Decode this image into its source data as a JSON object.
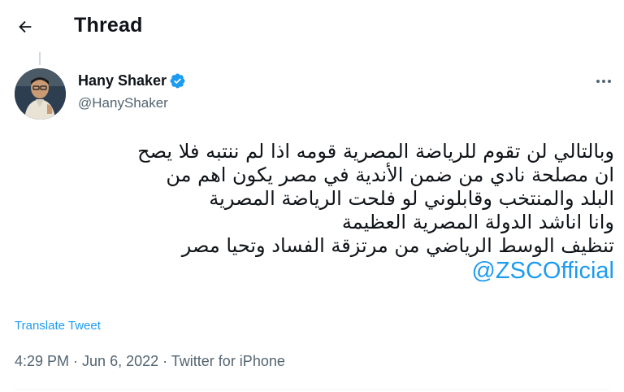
{
  "header": {
    "title": "Thread"
  },
  "tweet": {
    "author_name": "Hany Shaker",
    "author_handle": "@HanyShaker",
    "verified": true,
    "lines": [
      "وبالتالي لن تقوم للرياضة المصرية قومه اذا لم ننتبه  فلا يصح",
      "ان مصلحة نادي من ضمن الأندية في مصر يكون اهم من",
      "البلد والمنتخب وقابلوني لو فلحت الرياضة المصرية",
      "وانا اناشد الدولة  المصرية العظيمة",
      "تنظيف الوسط الرياضي من مرتزقة الفساد وتحيا مصر"
    ],
    "mention": "@ZSCOfficial",
    "translate_label": "Translate Tweet",
    "time": "4:29 PM",
    "date": "Jun 6, 2022",
    "source": "Twitter for iPhone",
    "separator": " · "
  },
  "icons": {
    "back": "arrow-left-icon",
    "verified": "verified-badge-icon",
    "more": "more-horizontal-icon"
  },
  "colors": {
    "accent": "#1d9bf0",
    "text": "#0f1419",
    "secondary": "#536471"
  }
}
